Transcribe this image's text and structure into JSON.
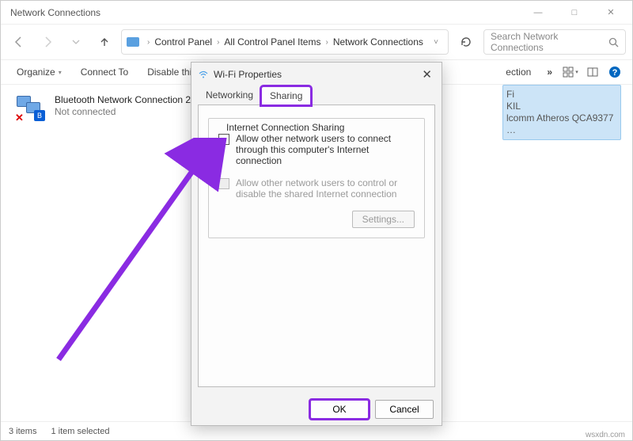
{
  "window": {
    "title": "Network Connections",
    "minimize": "—",
    "maximize": "□",
    "close": "✕"
  },
  "breadcrumb": {
    "sep": "›",
    "items": [
      "Control Panel",
      "All Control Panel Items",
      "Network Connections"
    ]
  },
  "search": {
    "placeholder": "Search Network Connections"
  },
  "toolbar": {
    "organize": "Organize",
    "connect_to": "Connect To",
    "disable_this": "Disable this n",
    "ection": "ection",
    "overflow": "»"
  },
  "connections": {
    "bluetooth": {
      "name": "Bluetooth Network Connection 2",
      "status": "Not connected",
      "bt_glyph": "B"
    },
    "wifi_partial": {
      "l1": "Fi",
      "l2": "KIL",
      "l3": "lcomm Atheros QCA9377 …"
    }
  },
  "dialog": {
    "title": "Wi-Fi Properties",
    "close": "✕",
    "tabs": {
      "networking": "Networking",
      "sharing": "Sharing"
    },
    "group_label": "Internet Connection Sharing",
    "chk1": "Allow other network users to connect through this computer's Internet connection",
    "chk2": "Allow other network users to control or disable the shared Internet connection",
    "settings": "Settings...",
    "ok": "OK",
    "cancel": "Cancel"
  },
  "statusbar": {
    "count": "3 items",
    "selected": "1 item selected"
  },
  "watermark": "wsxdn.com"
}
